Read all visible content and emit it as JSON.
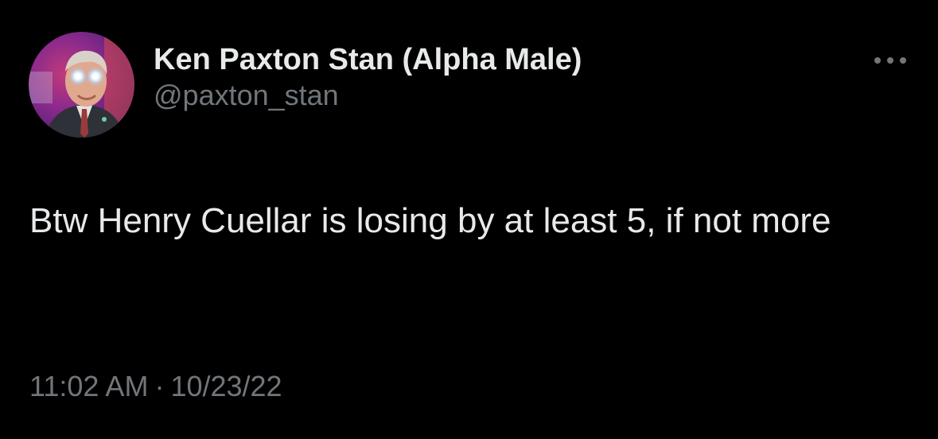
{
  "tweet": {
    "author": {
      "display_name": "Ken Paxton Stan (Alpha Male)",
      "handle": "@paxton_stan"
    },
    "text": "Btw Henry Cuellar is losing by at least 5, if not more",
    "timestamp": {
      "time": "11:02 AM",
      "separator": "·",
      "date": "10/23/22"
    },
    "more_icon": "ellipsis-icon"
  },
  "colors": {
    "background": "#000000",
    "primary_text": "#e7e9ea",
    "secondary_text": "#71767b"
  }
}
